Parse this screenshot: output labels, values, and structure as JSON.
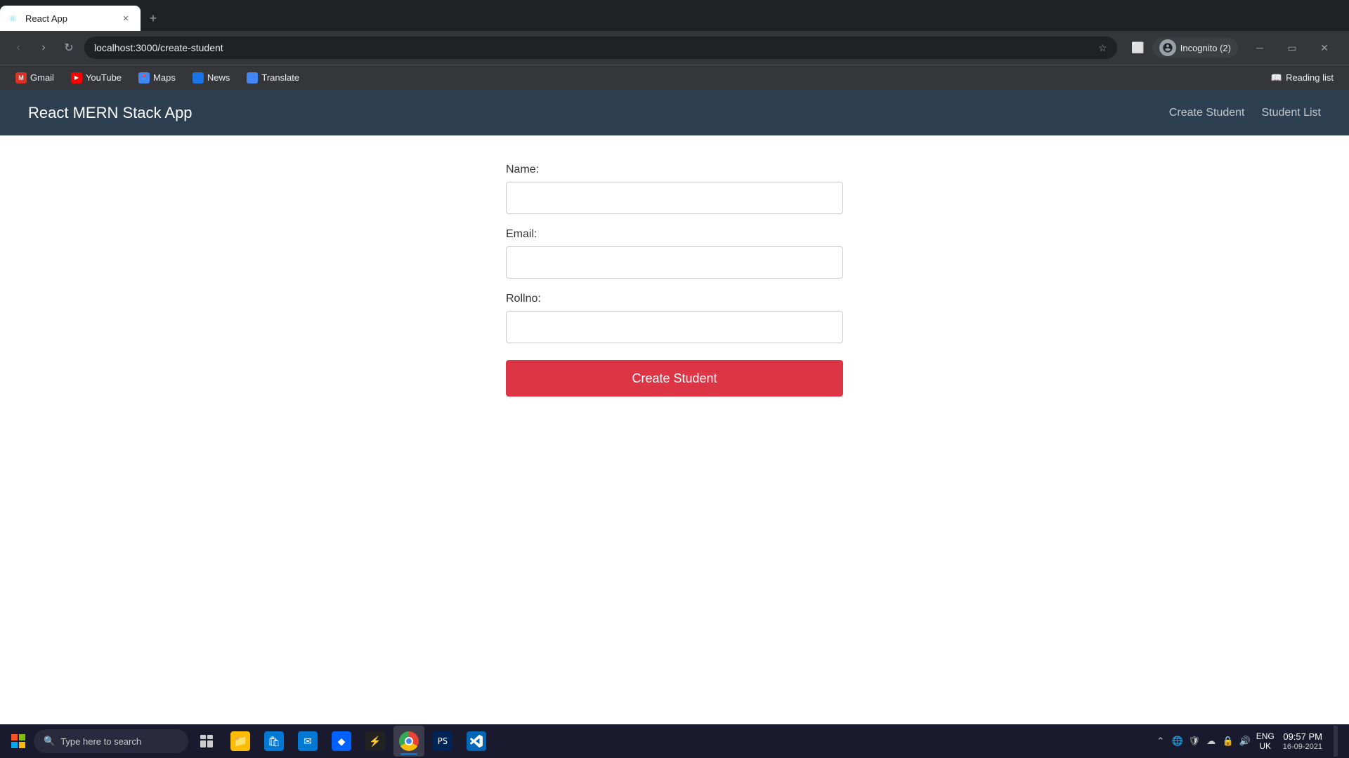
{
  "browser": {
    "tab": {
      "title": "React App",
      "favicon": "⚛",
      "url": "localhost:3000/create-student"
    },
    "controls": {
      "back": "‹",
      "forward": "›",
      "reload": "↻",
      "new_tab": "+"
    },
    "address": "localhost:3000/create-student",
    "incognito": "Incognito (2)",
    "reading_list": "Reading list",
    "bookmarks": [
      {
        "label": "Gmail",
        "icon": "gmail"
      },
      {
        "label": "YouTube",
        "icon": "youtube"
      },
      {
        "label": "Maps",
        "icon": "maps"
      },
      {
        "label": "News",
        "icon": "news"
      },
      {
        "label": "Translate",
        "icon": "translate"
      }
    ]
  },
  "app": {
    "brand": "React MERN Stack App",
    "nav": {
      "create_student": "Create Student",
      "student_list": "Student List"
    }
  },
  "form": {
    "name_label": "Name:",
    "email_label": "Email:",
    "rollno_label": "Rollno:",
    "name_value": "",
    "email_value": "",
    "rollno_value": "",
    "submit_label": "Create Student"
  },
  "taskbar": {
    "search_placeholder": "Type here to search",
    "datetime": {
      "time": "09:57 PM",
      "date": "16-09-2021",
      "tz": "UK"
    },
    "lang": "ENG\nUK"
  }
}
